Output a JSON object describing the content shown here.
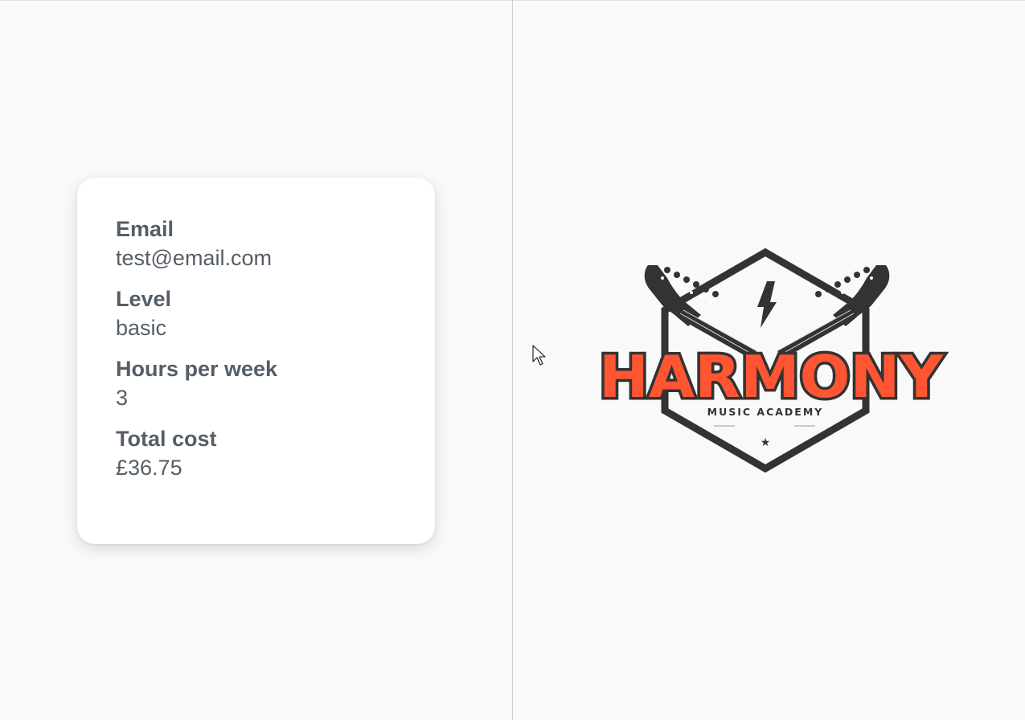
{
  "details": {
    "email_label": "Email",
    "email_value": "test@email.com",
    "level_label": "Level",
    "level_value": "basic",
    "hours_label": "Hours per week",
    "hours_value": "3",
    "cost_label": "Total cost",
    "cost_value": "£36.75"
  },
  "logo": {
    "name": "HARMONY",
    "tagline": "MUSIC ACADEMY",
    "star": "★",
    "colors": {
      "primary": "#ff5533",
      "dark": "#333333"
    }
  },
  "theme": {
    "background": "#f9f9f9",
    "card": "#ffffff",
    "text": "#555e66",
    "divider": "#cfcfcf"
  },
  "icons": {
    "cursor": "mouse-pointer-icon",
    "bolt": "lightning-bolt-icon",
    "guitar": "guitar-headstock-icon"
  }
}
